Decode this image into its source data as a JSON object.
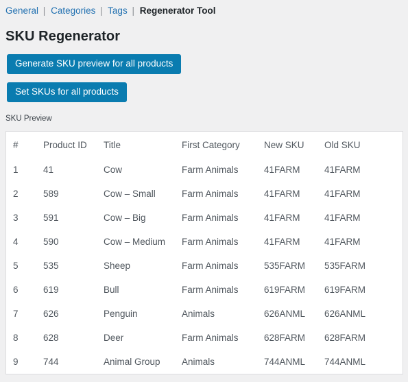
{
  "nav": {
    "links": [
      {
        "label": "General",
        "current": false
      },
      {
        "label": "Categories",
        "current": false
      },
      {
        "label": "Tags",
        "current": false
      },
      {
        "label": "Regenerator Tool",
        "current": true
      }
    ],
    "separator": "|"
  },
  "page": {
    "title": "SKU Regenerator"
  },
  "actions": {
    "generate_label": "Generate SKU preview for all products",
    "set_label": "Set SKUs for all products",
    "button_color": "#0a7cb0"
  },
  "preview": {
    "label": "SKU Preview",
    "columns": [
      "#",
      "Product ID",
      "Title",
      "First Category",
      "New SKU",
      "Old SKU"
    ],
    "rows": [
      {
        "num": "1",
        "product_id": "41",
        "title": "Cow",
        "first_category": "Farm Animals",
        "new_sku": "41FARM",
        "old_sku": "41FARM"
      },
      {
        "num": "2",
        "product_id": "589",
        "title": "Cow – Small",
        "first_category": "Farm Animals",
        "new_sku": "41FARM",
        "old_sku": "41FARM"
      },
      {
        "num": "3",
        "product_id": "591",
        "title": "Cow – Big",
        "first_category": "Farm Animals",
        "new_sku": "41FARM",
        "old_sku": "41FARM"
      },
      {
        "num": "4",
        "product_id": "590",
        "title": "Cow – Medium",
        "first_category": "Farm Animals",
        "new_sku": "41FARM",
        "old_sku": "41FARM"
      },
      {
        "num": "5",
        "product_id": "535",
        "title": "Sheep",
        "first_category": "Farm Animals",
        "new_sku": "535FARM",
        "old_sku": "535FARM"
      },
      {
        "num": "6",
        "product_id": "619",
        "title": "Bull",
        "first_category": "Farm Animals",
        "new_sku": "619FARM",
        "old_sku": "619FARM"
      },
      {
        "num": "7",
        "product_id": "626",
        "title": "Penguin",
        "first_category": "Animals",
        "new_sku": "626ANML",
        "old_sku": "626ANML"
      },
      {
        "num": "8",
        "product_id": "628",
        "title": "Deer",
        "first_category": "Farm Animals",
        "new_sku": "628FARM",
        "old_sku": "628FARM"
      },
      {
        "num": "9",
        "product_id": "744",
        "title": "Animal Group",
        "first_category": "Animals",
        "new_sku": "744ANML",
        "old_sku": "744ANML"
      }
    ]
  }
}
